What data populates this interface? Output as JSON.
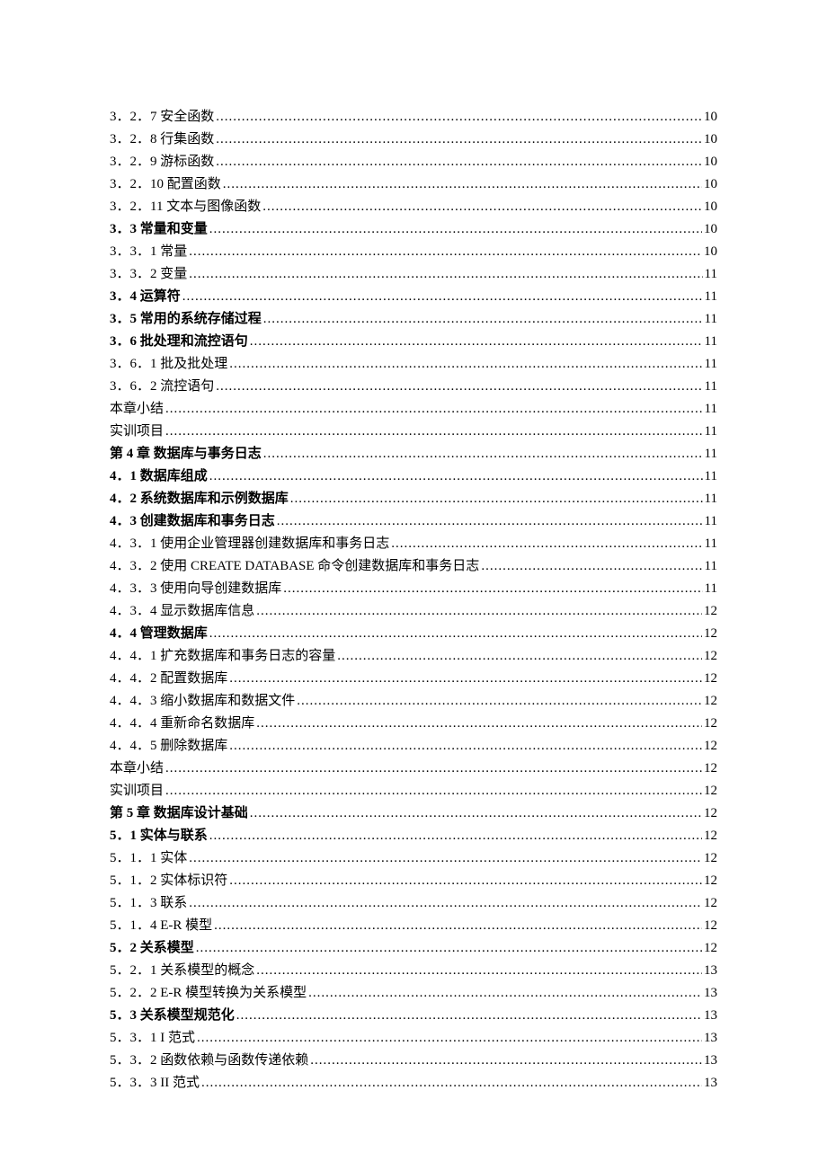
{
  "entries": [
    {
      "title": "3．2．7 安全函数",
      "page": "10",
      "font": "ff-song"
    },
    {
      "title": "3．2．8 行集函数",
      "page": "10",
      "font": "ff-song"
    },
    {
      "title": "3．2．9 游标函数",
      "page": "10",
      "font": "ff-song"
    },
    {
      "title": "3．2．10 配置函数",
      "page": "10",
      "font": "ff-song"
    },
    {
      "title": "3．2．11 文本与图像函数",
      "page": "10",
      "font": "ff-song"
    },
    {
      "title": "3．3 常量和变量",
      "page": "10",
      "font": "ff-kai fw-bold"
    },
    {
      "title": "3．3．1 常量",
      "page": "10",
      "font": "ff-song"
    },
    {
      "title": "3．3．2 变量",
      "page": "11",
      "font": "ff-song"
    },
    {
      "title": "3．4 运算符",
      "page": "11",
      "font": "ff-kai fw-bold"
    },
    {
      "title": "3．5 常用的系统存储过程",
      "page": "11",
      "font": "ff-kai fw-bold"
    },
    {
      "title": "3．6 批处理和流控语句",
      "page": "11",
      "font": "ff-kai fw-bold"
    },
    {
      "title": "3．6．1 批及批处理",
      "page": "11",
      "font": "ff-song"
    },
    {
      "title": "3．6．2 流控语句",
      "page": "11",
      "font": "ff-song"
    },
    {
      "title": "本章小结",
      "page": "11",
      "font": "ff-song"
    },
    {
      "title": "实训项目",
      "page": "11",
      "font": "ff-song"
    },
    {
      "title": "第 4 章  数据库与事务日志",
      "page": "11",
      "font": "ff-kai fw-bold"
    },
    {
      "title": "4．1 数据库组成",
      "page": "11",
      "font": "ff-kai fw-bold"
    },
    {
      "title": "4．2 系统数据库和示例数据库",
      "page": "11",
      "font": "ff-kai fw-bold"
    },
    {
      "title": "4．3 创建数据库和事务日志",
      "page": "11",
      "font": "ff-kai fw-bold"
    },
    {
      "title": "4．3．1 使用企业管理器创建数据库和事务日志",
      "page": "11",
      "font": "ff-song"
    },
    {
      "title": "4．3．2 使用 CREATE DATABASE 命令创建数据库和事务日志",
      "page": "11",
      "font": "ff-song"
    },
    {
      "title": "4．3．3 使用向导创建数据库",
      "page": "11",
      "font": "ff-song"
    },
    {
      "title": "4．3．4 显示数据库信息",
      "page": "12",
      "font": "ff-song"
    },
    {
      "title": "4．4 管理数据库",
      "page": "12",
      "font": "ff-kai fw-bold"
    },
    {
      "title": "4．4．1 扩充数据库和事务日志的容量",
      "page": "12",
      "font": "ff-song"
    },
    {
      "title": "4．4．2 配置数据库",
      "page": "12",
      "font": "ff-song"
    },
    {
      "title": "4．4．3 缩小数据库和数据文件",
      "page": "12",
      "font": "ff-song"
    },
    {
      "title": "4．4．4 重新命名数据库",
      "page": "12",
      "font": "ff-song"
    },
    {
      "title": "4．4．5 删除数据库",
      "page": "12",
      "font": "ff-song"
    },
    {
      "title": "本章小结",
      "page": "12",
      "font": "ff-song"
    },
    {
      "title": "实训项目",
      "page": "12",
      "font": "ff-song"
    },
    {
      "title": "第 5 章  数据库设计基础",
      "page": "12",
      "font": "ff-kai fw-bold"
    },
    {
      "title": "5．1 实体与联系",
      "page": "12",
      "font": "ff-kai fw-bold"
    },
    {
      "title": "5．1．1 实体",
      "page": "12",
      "font": "ff-song"
    },
    {
      "title": "5．1．2 实体标识符",
      "page": "12",
      "font": "ff-song"
    },
    {
      "title": "5．1．3 联系",
      "page": "12",
      "font": "ff-song"
    },
    {
      "title": "5．1．4 E-R 模型",
      "page": "12",
      "font": "ff-song"
    },
    {
      "title": "5．2 关系模型",
      "page": "12",
      "font": "ff-kai fw-bold"
    },
    {
      "title": "5．2．1 关系模型的概念",
      "page": "13",
      "font": "ff-song"
    },
    {
      "title": "5．2．2 E-R 模型转换为关系模型",
      "page": "13",
      "font": "ff-song"
    },
    {
      "title": "5．3 关系模型规范化",
      "page": "13",
      "font": "ff-kai fw-bold"
    },
    {
      "title": "5．3．1 I 范式",
      "page": "13",
      "font": "ff-song"
    },
    {
      "title": "5．3．2 函数依赖与函数传递依赖",
      "page": "13",
      "font": "ff-song"
    },
    {
      "title": "5．3．3 II 范式",
      "page": "13",
      "font": "ff-song"
    }
  ]
}
